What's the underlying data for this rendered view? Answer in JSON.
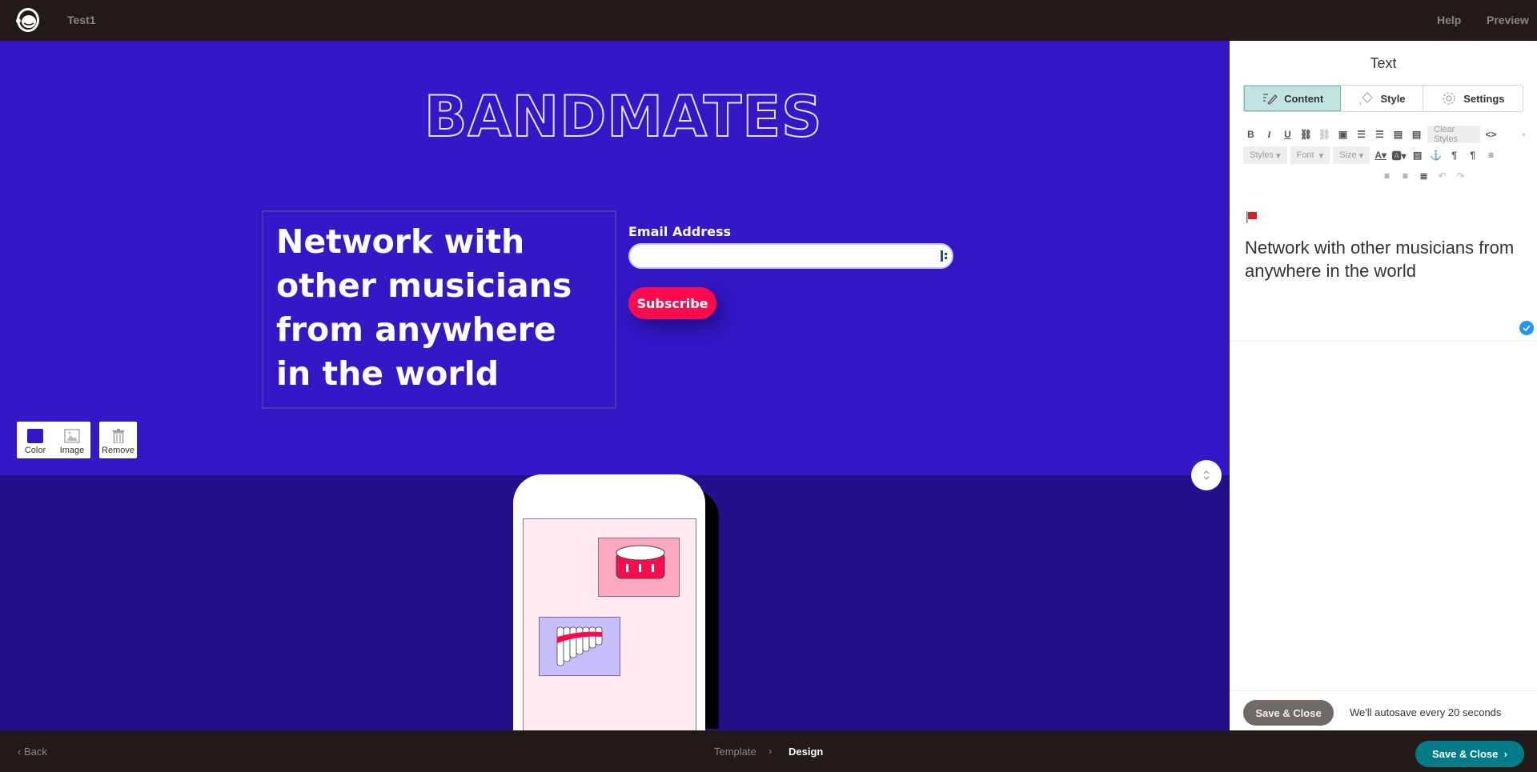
{
  "topbar": {
    "logo_icon": "mailchimp-freddie-icon",
    "doc_title": "Test1",
    "help": "Help",
    "preview": "Preview"
  },
  "canvas": {
    "brand": "BANDMATES",
    "headline": "Network with other musicians from anywhere in the world",
    "email_label": "Email Address",
    "email_value": "",
    "subscribe": "Subscribe",
    "bg_tools": {
      "color": "Color",
      "image": "Image",
      "remove": "Remove"
    },
    "colors": {
      "hero_bg": "#3418c8",
      "lower_bg": "#22118a",
      "subscribe_bg": "#ff0a4e"
    }
  },
  "panel": {
    "title": "Text",
    "tabs": [
      {
        "label": "Content",
        "icon": "pencil-lines-icon",
        "active": true
      },
      {
        "label": "Style",
        "icon": "paint-bucket-icon",
        "active": false
      },
      {
        "label": "Settings",
        "icon": "gear-icon",
        "active": false
      }
    ],
    "toolbar": {
      "row1": [
        "B",
        "I",
        "U",
        "link",
        "unlink",
        "image",
        "ordered-list",
        "bullet-list",
        "paste",
        "paste-text"
      ],
      "clear_styles": "Clear Styles",
      "styles": "Styles",
      "font": "Font",
      "size": "Size"
    },
    "editor_text": "Network with other musicians from anywhere in the world",
    "footer": {
      "save_close": "Save & Close",
      "autosave": "We'll autosave every 20 seconds"
    }
  },
  "bottombar": {
    "back": "Back",
    "breadcrumb": [
      "Template",
      "Design"
    ],
    "save_close": "Save & Close",
    "accent": "#007c89"
  }
}
